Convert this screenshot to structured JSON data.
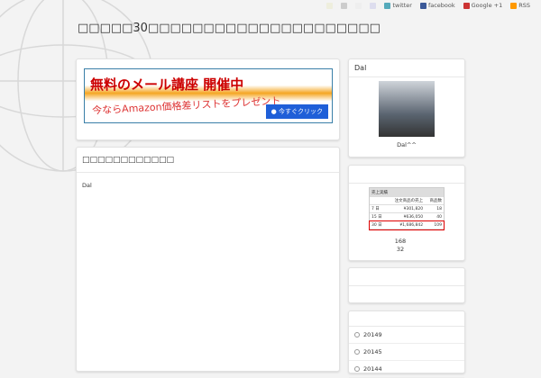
{
  "topbar": {
    "links": [
      "twitter",
      "facebook",
      "Google +1",
      "RSS"
    ]
  },
  "header": {
    "title": "□□□□□30□□□□□□□□□□□□□□□□□□□□□"
  },
  "banner": {
    "line1": "無料のメール講座 開催中",
    "line2": "今ならAmazon価格差リストをプレゼント",
    "button": "● 今すぐクリック"
  },
  "post": {
    "heading": "□□□□□□□□□□□□",
    "body": "Dal"
  },
  "profile": {
    "heading": "Dal",
    "caption": "Dal^^"
  },
  "sales": {
    "widget_title": "売上実績",
    "headers": [
      "",
      "注文商品の売上",
      "商品数"
    ],
    "rows": [
      [
        "7 日",
        "¥301,820",
        "18"
      ],
      [
        "15 日",
        "¥636,050",
        "40"
      ],
      [
        "30 日",
        "¥1,686,842",
        "109"
      ]
    ],
    "num1": "168",
    "num2": "32"
  },
  "archives": [
    "20149",
    "20145",
    "20144"
  ],
  "colors": {
    "accent": "#d33",
    "banner_button": "#1f5fd8"
  }
}
